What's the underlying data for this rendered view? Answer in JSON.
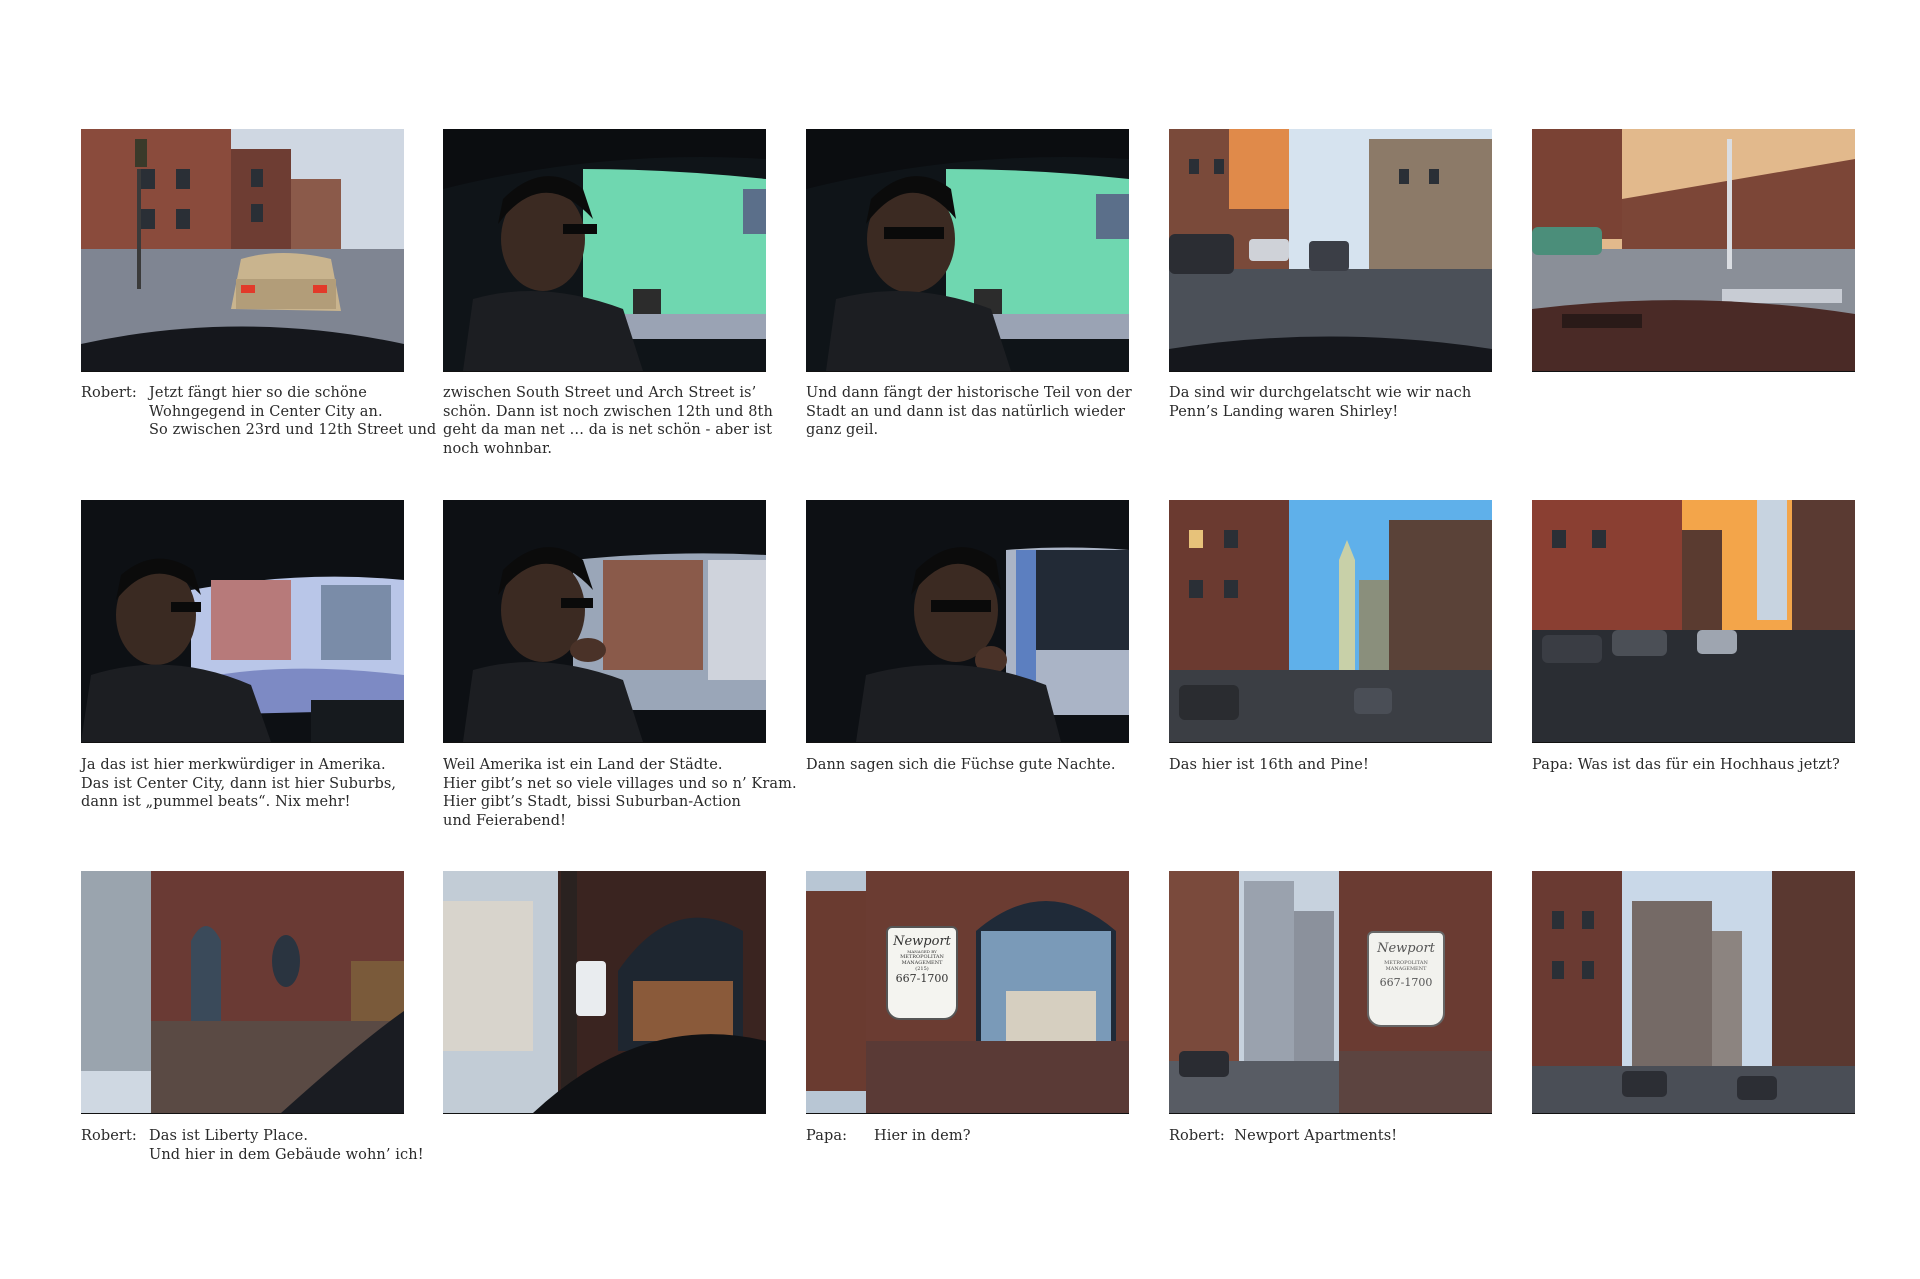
{
  "frames": [
    {
      "scene": "street-car-ahead",
      "caption": {
        "speaker": "Robert:",
        "lines": [
          "Jetzt fängt hier so die schöne",
          "Wohngegend in Center City an.",
          "So zwischen 23rd und 12th Street und"
        ]
      }
    },
    {
      "scene": "driver-profile-green",
      "caption": {
        "speaker": "",
        "lines": [
          "zwischen South Street und Arch Street is’",
          "schön. Dann ist noch zwischen 12th und 8th",
          "geht da man net … da is net schön - aber ist",
          "noch wohnbar."
        ]
      }
    },
    {
      "scene": "driver-facing-green",
      "caption": {
        "speaker": "",
        "lines": [
          "Und dann fängt der historische Teil von der",
          "Stadt an und dann ist das natürlich wieder",
          "ganz geil."
        ]
      }
    },
    {
      "scene": "street-cars-parked",
      "caption": {
        "speaker": "",
        "lines": [
          "Da sind wir durchgelatscht wie wir nach",
          "Penn’s Landing waren Shirley!"
        ]
      }
    },
    {
      "scene": "intersection-brick",
      "caption": {
        "speaker": "",
        "lines": []
      }
    },
    {
      "scene": "driver-laughing",
      "caption": {
        "speaker": "",
        "lines": [
          "Ja das ist hier merkwürdiger in Amerika.",
          "Das ist Center City, dann ist hier Suburbs,",
          "dann ist „pummel beats“.  Nix mehr!"
        ]
      }
    },
    {
      "scene": "driver-hand-chin",
      "caption": {
        "speaker": "",
        "lines": [
          "Weil Amerika ist ein Land der Städte.",
          "Hier gibt’s net so viele villages und so n’ Kram.",
          "Hier gibt’s Stadt, bissi Suburban-Action",
          "und Feierabend!"
        ]
      }
    },
    {
      "scene": "driver-thinking",
      "caption": {
        "speaker": "",
        "lines": [
          "Dann sagen sich die Füchse gute Nachte."
        ]
      }
    },
    {
      "scene": "street-skyscraper",
      "caption": {
        "speaker": "",
        "lines": [
          "Das hier ist 16th and Pine!"
        ]
      }
    },
    {
      "scene": "street-sunset",
      "caption": {
        "speaker": "",
        "lines": [
          "Papa: Was ist das für ein Hochhaus jetzt?"
        ]
      }
    },
    {
      "scene": "building-arch-window",
      "caption": {
        "speaker": "Robert:",
        "lines": [
          "Das ist Liberty Place.",
          "Und hier in dem Gebäude wohn’ ich!"
        ]
      }
    },
    {
      "scene": "building-sign-dark",
      "caption": {
        "speaker": "",
        "lines": []
      }
    },
    {
      "scene": "newport-sign-close",
      "caption": {
        "speaker": "Papa:",
        "lines": [
          "Hier in dem?"
        ]
      }
    },
    {
      "scene": "newport-sign-street",
      "caption": {
        "speaker": "Robert:",
        "lines": [
          "Newport Apartments!"
        ]
      }
    },
    {
      "scene": "street-tall-buildings",
      "caption": {
        "speaker": "",
        "lines": []
      }
    }
  ],
  "sign": {
    "brand": "Newport",
    "sub1": "MANAGED BY",
    "sub2": "METROPOLITAN",
    "sub3": "MANAGEMENT",
    "area": "(215)",
    "phone": "667-1700"
  },
  "colors": {
    "dash": "#15171c",
    "sky": "#c9d6e6",
    "brick": "#7a4234",
    "interior": "#101418",
    "window_green": "#6fd7b0"
  }
}
